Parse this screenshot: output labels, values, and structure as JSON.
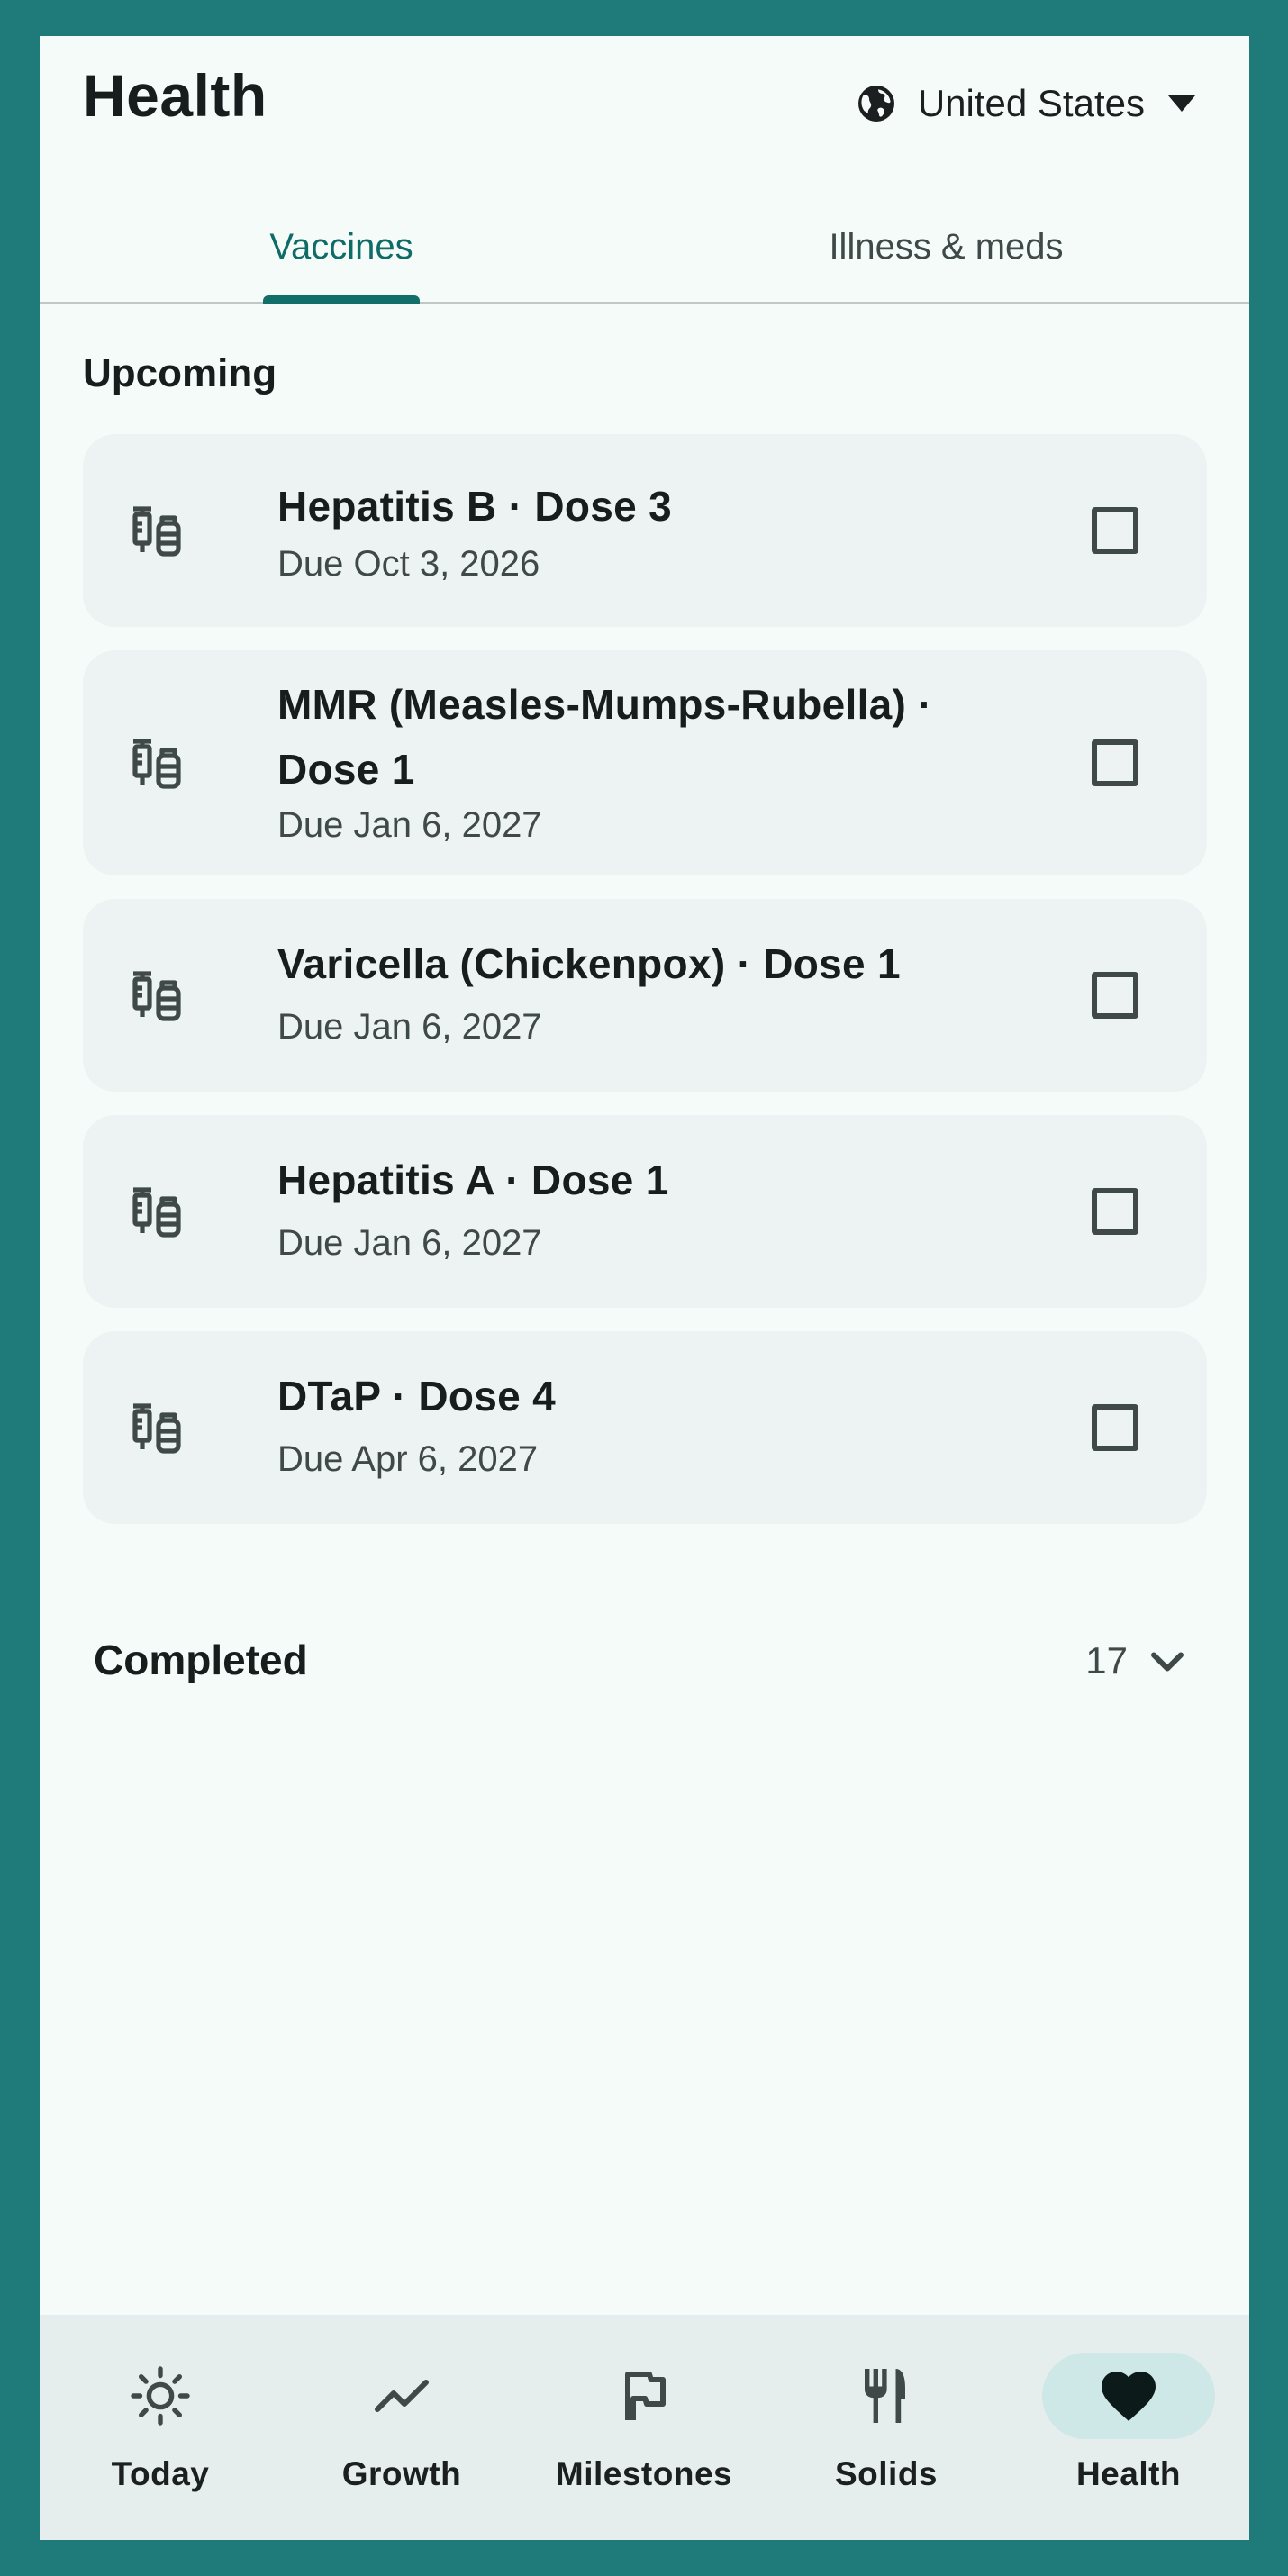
{
  "header": {
    "title": "Health",
    "region_label": "United States"
  },
  "tabs": [
    {
      "label": "Vaccines",
      "active": true
    },
    {
      "label": "Illness & meds",
      "active": false
    }
  ],
  "upcoming": {
    "title": "Upcoming",
    "items": [
      {
        "title": "Hepatitis B · Dose 3",
        "due": "Due Oct 3, 2026",
        "checked": false
      },
      {
        "title": "MMR (Measles-Mumps-Rubella) · Dose 1",
        "due": "Due Jan 6, 2027",
        "checked": false
      },
      {
        "title": "Varicella (Chickenpox) · Dose 1",
        "due": "Due Jan 6, 2027",
        "checked": false
      },
      {
        "title": "Hepatitis A · Dose 1",
        "due": "Due Jan 6, 2027",
        "checked": false
      },
      {
        "title": "DTaP · Dose 4",
        "due": "Due Apr 6, 2027",
        "checked": false
      }
    ]
  },
  "completed": {
    "label": "Completed",
    "count": "17"
  },
  "nav": [
    {
      "label": "Today",
      "icon": "sun-icon",
      "active": false
    },
    {
      "label": "Growth",
      "icon": "trending-up-icon",
      "active": false
    },
    {
      "label": "Milestones",
      "icon": "flag-icon",
      "active": false
    },
    {
      "label": "Solids",
      "icon": "utensils-icon",
      "active": false
    },
    {
      "label": "Health",
      "icon": "heart-icon",
      "active": true
    }
  ],
  "colors": {
    "frame": "#1f7b7a",
    "accent": "#126e69",
    "surface": "#f4fbf8",
    "card": "#edf3f2"
  }
}
